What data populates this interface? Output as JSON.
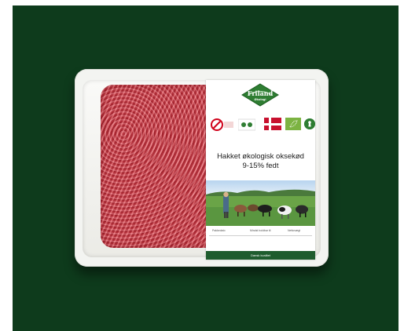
{
  "brand": {
    "name": "Friland",
    "subtitle": "Økologi",
    "logo_color": "#2e7d32"
  },
  "product": {
    "title_line1": "Hakket økologisk oksekød",
    "title_line2": "9-15% fedt"
  },
  "label_fields": {
    "field1": "Pakkedato",
    "field2": "Mindst holdbar til",
    "field3": "Nettovægt"
  },
  "footer_text": "Dansk kvalitet",
  "certifications": [
    "danish-organic-mark-icon",
    "fb-certification-icon",
    "danish-flag-icon",
    "eu-organic-leaf-icon",
    "keyhole-icon"
  ],
  "colors": {
    "background": "#0e3b1c",
    "tray": "#f3f4f1",
    "meat": "#c43b46",
    "label_footer": "#1f5c2e"
  }
}
